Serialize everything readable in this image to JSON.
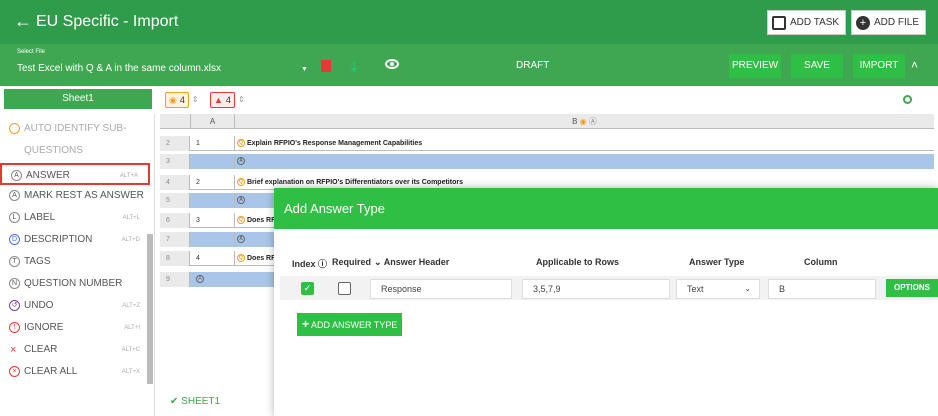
{
  "header": {
    "title": "EU Specific - Import",
    "add_task_label": "ADD TASK",
    "add_file_label": "ADD FILE"
  },
  "file_bar": {
    "select_label": "Select File",
    "file_name": "Test Excel with Q & A in the same column.xlsx",
    "status": "DRAFT",
    "preview_label": "PREVIEW",
    "save_label": "SAVE",
    "import_label": "IMPORT"
  },
  "sheet": {
    "name": "Sheet1",
    "question_count": "4",
    "warning_count": "4",
    "bottom_tab": "SHEET1"
  },
  "sidebar": {
    "items": [
      {
        "label": "AUTO IDENTIFY SUB-",
        "shortcut": ""
      },
      {
        "label": "QUESTIONS",
        "shortcut": ""
      },
      {
        "label": "ANSWER",
        "shortcut": "ALT+A"
      },
      {
        "label": "MARK REST AS ANSWER",
        "shortcut": ""
      },
      {
        "label": "LABEL",
        "shortcut": "ALT+L"
      },
      {
        "label": "DESCRIPTION",
        "shortcut": "ALT+D"
      },
      {
        "label": "TAGS",
        "shortcut": ""
      },
      {
        "label": "QUESTION NUMBER",
        "shortcut": ""
      },
      {
        "label": "UNDO",
        "shortcut": "ALT+Z"
      },
      {
        "label": "IGNORE",
        "shortcut": "ALT+I"
      },
      {
        "label": "CLEAR",
        "shortcut": "ALT+C"
      },
      {
        "label": "CLEAR ALL",
        "shortcut": "ALT+X"
      }
    ]
  },
  "grid": {
    "col_a": "A",
    "col_b": "B",
    "rows": [
      {
        "num": "2",
        "a": "1",
        "b": "Explain RFPIO's Response Management Capabilities"
      },
      {
        "num": "3",
        "a": "",
        "b": ""
      },
      {
        "num": "4",
        "a": "2",
        "b": "Brief explanation on RFPIO's Differentiators over its Competitors"
      },
      {
        "num": "5",
        "a": "",
        "b": ""
      },
      {
        "num": "6",
        "a": "3",
        "b": "Does RFPI"
      },
      {
        "num": "7",
        "a": "",
        "b": ""
      },
      {
        "num": "8",
        "a": "4",
        "b": "Does RFPI"
      },
      {
        "num": "9",
        "a": "",
        "b": ""
      }
    ]
  },
  "modal": {
    "title": "Add Answer Type",
    "headers": {
      "index": "Index",
      "required": "Required",
      "answer_header": "Answer Header",
      "applicable_rows": "Applicable to Rows",
      "answer_type": "Answer Type",
      "column": "Column"
    },
    "row": {
      "answer_header": "Response",
      "applicable_rows": "3,5,7,9",
      "answer_type": "Text",
      "column": "B",
      "options_label": "OPTIONS"
    },
    "add_label": "ADD ANSWER TYPE"
  }
}
